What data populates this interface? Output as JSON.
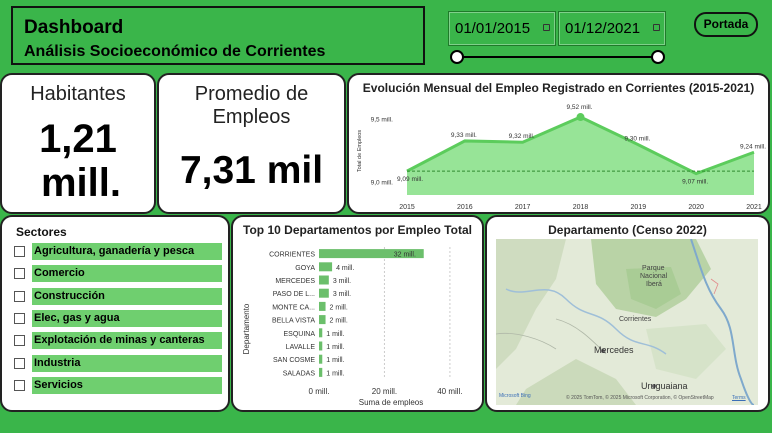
{
  "header": {
    "title": "Dashboard",
    "subtitle": "Análisis Socioeconómico de Corrientes"
  },
  "date_filter": {
    "start": "01/01/2015",
    "end": "01/12/2021"
  },
  "nav": {
    "portada_label": "Portada"
  },
  "kpis": {
    "habitantes": {
      "label": "Habitantes",
      "value_line1": "1,21",
      "value_line2": "mill."
    },
    "empleos": {
      "label_line1": "Promedio de",
      "label_line2": "Empleos",
      "value": "7,31 mil"
    }
  },
  "employment_chart": {
    "title": "Evolución Mensual del Empleo Registrado en Corrientes (2015-2021)",
    "chart_data": {
      "type": "area",
      "x": [
        "2015",
        "2016",
        "2017",
        "2018",
        "2019",
        "2020",
        "2021"
      ],
      "values": [
        9.09,
        9.33,
        9.32,
        9.52,
        9.3,
        9.07,
        9.24
      ],
      "data_labels": [
        "9,09 mill.",
        "9,33 mill.",
        "9,32 mill.",
        "9,52 mill.",
        "9,30 mill.",
        "9,07 mill.",
        "9,24 mill."
      ],
      "ylabel": "Total de Empleos",
      "y_ticks": [
        "9,5 mill.",
        "9,0 mill."
      ],
      "ylim": [
        8.9,
        9.6
      ],
      "color": "#6bd86b",
      "line_color": "#5ccc5c",
      "reference_line": 9.09
    }
  },
  "sectors": {
    "title": "Sectores",
    "items": [
      "Agricultura, ganadería y pesca",
      "Comercio",
      "Construcción",
      "Elec, gas y agua",
      "Explotación de minas y canteras",
      "Industria",
      "Servicios"
    ]
  },
  "top_departments": {
    "title": "Top 10 Departamentos por Empleo Total",
    "chart_data": {
      "type": "bar",
      "orientation": "horizontal",
      "categories": [
        "CORRIENTES",
        "GOYA",
        "MERCEDES",
        "PASO DE L...",
        "MONTE CA...",
        "BELLA VISTA",
        "ESQUINA",
        "LAVALLE",
        "SAN COSME",
        "SALADAS"
      ],
      "values": [
        32,
        4,
        3,
        3,
        2,
        2,
        1,
        1,
        1,
        1
      ],
      "data_labels": [
        "32 mill.",
        "4 mill.",
        "3 mill.",
        "3 mill.",
        "2 mill.",
        "2 mill.",
        "1 mill.",
        "1 mill.",
        "1 mill.",
        "1 mill."
      ],
      "xlabel": "Suma de empleos",
      "ylabel": "Departamento",
      "x_ticks": [
        "0 mill.",
        "20 mill.",
        "40 mill."
      ],
      "xlim": [
        0,
        44
      ],
      "color": "#6bbf6b"
    }
  },
  "map": {
    "title": "Departamento (Censo 2022)",
    "labels": {
      "parque": "Parque",
      "nacional": "Nacional",
      "ibera": "Iberá",
      "corrientes": "Corrientes",
      "mercedes": "Mercedes",
      "uruguaiana": "Uruguaiana"
    },
    "bing_logo": "Microsoft Bing",
    "attribution": "© 2025 TomTom, © 2025 Microsoft Corporation, © OpenStreetMap",
    "terms": "Terms"
  }
}
